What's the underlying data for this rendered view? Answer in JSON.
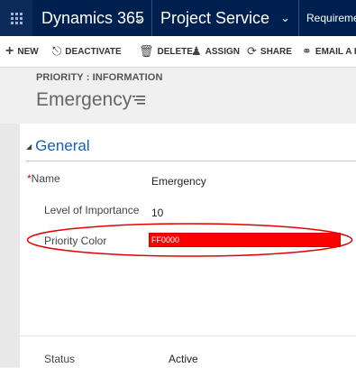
{
  "navbar": {
    "app_name": "Dynamics 365",
    "area_name": "Project Service",
    "entity_crumb": "Requireme"
  },
  "commands": {
    "new": "NEW",
    "deactivate": "DEACTIVATE",
    "delete": "DELETE",
    "assign": "ASSIGN",
    "share": "SHARE",
    "email": "EMAIL A L"
  },
  "header": {
    "entity_label": "PRIORITY : INFORMATION",
    "record_name": "Emergency"
  },
  "section": {
    "title": "General"
  },
  "fields": {
    "name_label": "Name",
    "name_value": "Emergency",
    "importance_label": "Level of Importance",
    "importance_value": "10",
    "color_label": "Priority Color",
    "color_value": "FF0000"
  },
  "footer": {
    "status_label": "Status",
    "status_value": "Active"
  },
  "colors": {
    "navbar": "#002050",
    "priority_color": "#ff0000",
    "section_accent": "#1160b7",
    "annotation": "#e00000"
  },
  "icons": {
    "app_launcher": "waffle-icon",
    "form_selector": "list-icon"
  }
}
